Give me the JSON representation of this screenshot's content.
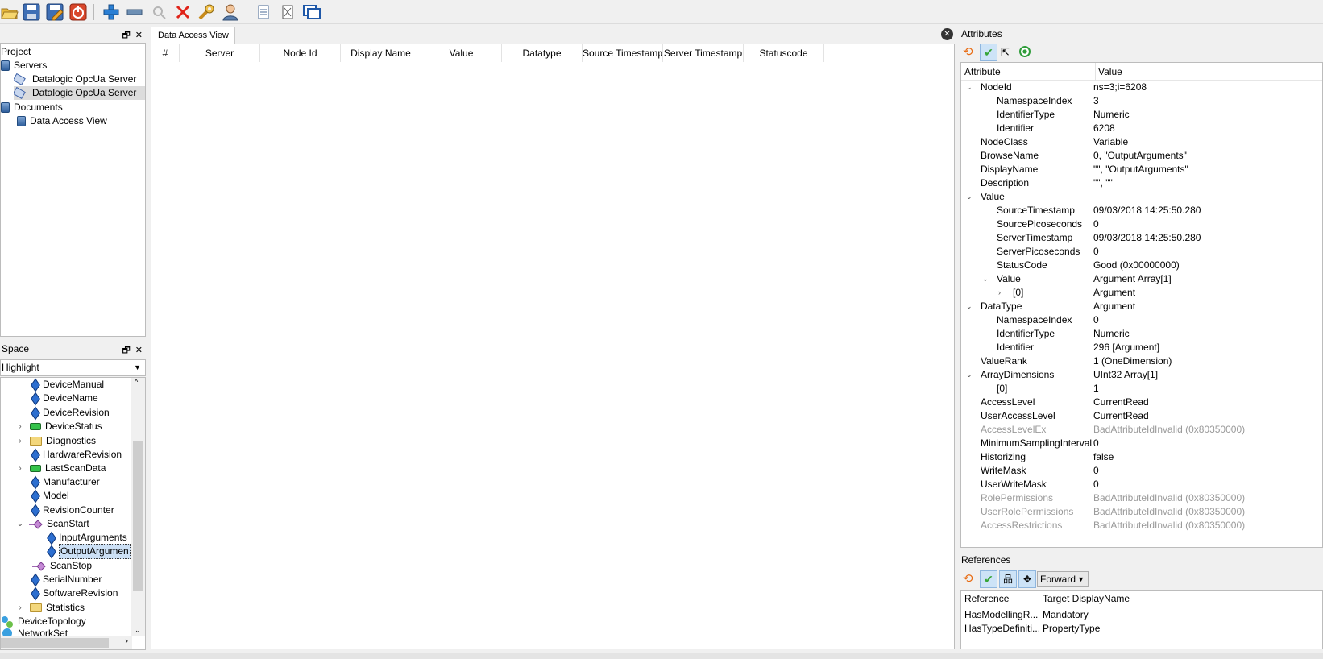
{
  "toolbar": {
    "icons": [
      "open-folder-icon",
      "save-icon",
      "edit-icon",
      "disconnect-icon",
      "add-icon",
      "remove-icon",
      "search-icon",
      "delete-icon",
      "settings-icon",
      "user-icon",
      "document-icon",
      "close-document-icon",
      "window-icon"
    ]
  },
  "project": {
    "title": "Project",
    "items": [
      {
        "label": "Servers"
      },
      {
        "label": "Datalogic OpcUa Server"
      },
      {
        "label": "Datalogic OpcUa Server"
      },
      {
        "label": "Documents"
      },
      {
        "label": "Data Access View"
      }
    ]
  },
  "space": {
    "title": "Space",
    "filter": "Highlight",
    "items": [
      {
        "label": "DeviceManual"
      },
      {
        "label": "DeviceName"
      },
      {
        "label": "DeviceRevision"
      },
      {
        "label": "DeviceStatus"
      },
      {
        "label": "Diagnostics"
      },
      {
        "label": "HardwareRevision"
      },
      {
        "label": "LastScanData"
      },
      {
        "label": "Manufacturer"
      },
      {
        "label": "Model"
      },
      {
        "label": "RevisionCounter"
      },
      {
        "label": "ScanStart"
      },
      {
        "label": "InputArguments"
      },
      {
        "label": "OutputArgumen"
      },
      {
        "label": "ScanStop"
      },
      {
        "label": "SerialNumber"
      },
      {
        "label": "SoftwareRevision"
      },
      {
        "label": "Statistics"
      },
      {
        "label": "DeviceTopology"
      },
      {
        "label": "NetworkSet"
      }
    ]
  },
  "dav": {
    "tab": "Data Access View",
    "columns": [
      "#",
      "Server",
      "Node Id",
      "Display Name",
      "Value",
      "Datatype",
      "Source Timestamp",
      "Server Timestamp",
      "Statuscode"
    ]
  },
  "attributes": {
    "title": "Attributes",
    "col_attr": "Attribute",
    "col_val": "Value",
    "rows": [
      {
        "a": "NodeId",
        "v": "ns=3;i=6208"
      },
      {
        "a": "NamespaceIndex",
        "v": "3"
      },
      {
        "a": "IdentifierType",
        "v": "Numeric"
      },
      {
        "a": "Identifier",
        "v": "6208"
      },
      {
        "a": "NodeClass",
        "v": "Variable"
      },
      {
        "a": "BrowseName",
        "v": "0, \"OutputArguments\""
      },
      {
        "a": "DisplayName",
        "v": "\"\", \"OutputArguments\""
      },
      {
        "a": "Description",
        "v": "\"\", \"\""
      },
      {
        "a": "Value",
        "v": ""
      },
      {
        "a": "SourceTimestamp",
        "v": "09/03/2018 14:25:50.280"
      },
      {
        "a": "SourcePicoseconds",
        "v": "0"
      },
      {
        "a": "ServerTimestamp",
        "v": "09/03/2018 14:25:50.280"
      },
      {
        "a": "ServerPicoseconds",
        "v": "0"
      },
      {
        "a": "StatusCode",
        "v": "Good (0x00000000)"
      },
      {
        "a": "Value",
        "v": "Argument Array[1]"
      },
      {
        "a": "[0]",
        "v": "Argument"
      },
      {
        "a": "DataType",
        "v": "Argument"
      },
      {
        "a": "NamespaceIndex",
        "v": "0"
      },
      {
        "a": "IdentifierType",
        "v": "Numeric"
      },
      {
        "a": "Identifier",
        "v": "296 [Argument]"
      },
      {
        "a": "ValueRank",
        "v": "1 (OneDimension)"
      },
      {
        "a": "ArrayDimensions",
        "v": "UInt32 Array[1]"
      },
      {
        "a": "[0]",
        "v": "1"
      },
      {
        "a": "AccessLevel",
        "v": "CurrentRead"
      },
      {
        "a": "UserAccessLevel",
        "v": "CurrentRead"
      },
      {
        "a": "AccessLevelEx",
        "v": "BadAttributeIdInvalid (0x80350000)"
      },
      {
        "a": "MinimumSamplingInterval",
        "v": "0"
      },
      {
        "a": "Historizing",
        "v": "false"
      },
      {
        "a": "WriteMask",
        "v": "0"
      },
      {
        "a": "UserWriteMask",
        "v": "0"
      },
      {
        "a": "RolePermissions",
        "v": "BadAttributeIdInvalid (0x80350000)"
      },
      {
        "a": "UserRolePermissions",
        "v": "BadAttributeIdInvalid (0x80350000)"
      },
      {
        "a": "AccessRestrictions",
        "v": "BadAttributeIdInvalid (0x80350000)"
      }
    ]
  },
  "references": {
    "title": "References",
    "direction": "Forward",
    "col_ref": "Reference",
    "col_target": "Target DisplayName",
    "rows": [
      {
        "r": "HasModellingR...",
        "t": "Mandatory"
      },
      {
        "r": "HasTypeDefiniti...",
        "t": "PropertyType"
      }
    ]
  }
}
